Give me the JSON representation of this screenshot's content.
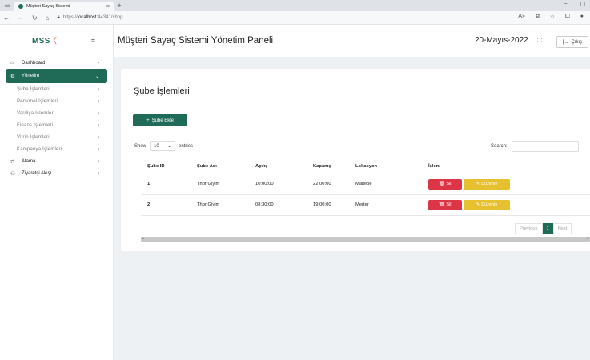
{
  "browser": {
    "tab_title": "Müşteri Sayaç Sistemi",
    "url_prefix": "https://",
    "url_host": "localhost",
    "url_rest": ":44341/shop"
  },
  "sidebar": {
    "logo": "MSS",
    "items": [
      {
        "label": "Dashboard",
        "icon": "home-icon"
      },
      {
        "label": "Yönetim",
        "icon": "settings-icon"
      },
      {
        "label": "Şube İşlemleri"
      },
      {
        "label": "Personel İşlemleri"
      },
      {
        "label": "Vardiya İşlemleri"
      },
      {
        "label": "Finans İşlemleri"
      },
      {
        "label": "Vitrin İşlemleri"
      },
      {
        "label": "Kampanya İşlemleri"
      },
      {
        "label": "Atama",
        "icon": "swap-icon"
      },
      {
        "label": "Ziyaretçi Akışı",
        "icon": "users-icon"
      }
    ]
  },
  "header": {
    "title": "Müşteri Sayaç Sistemi Yönetim Paneli",
    "date": "20-Mayıs-2022",
    "logout_label": "Çıkış"
  },
  "card": {
    "title": "Şube İşlemleri",
    "add_button": "Şube Ekle",
    "show_label": "Show",
    "entries_value": "10",
    "entries_label": "entries",
    "search_label": "Search:"
  },
  "table": {
    "headers": [
      "Şube ID",
      "Şube Adı",
      "Açılış",
      "Kapanış",
      "Lokasyon",
      "İşlem"
    ],
    "rows": [
      [
        "1",
        "Thor Giyim",
        "10:00:00",
        "22:00:00",
        "Maltepe"
      ],
      [
        "2",
        "Thor Giyim",
        "08:30:00",
        "19:00:00",
        "Merter"
      ]
    ],
    "delete_label": "Sil",
    "edit_label": "Düzenle"
  },
  "pagination": {
    "previous": "Previous",
    "current": "1",
    "next": "Next"
  },
  "colors": {
    "primary": "#1f6b57",
    "danger": "#dc3545",
    "warning": "#e6c02f"
  }
}
